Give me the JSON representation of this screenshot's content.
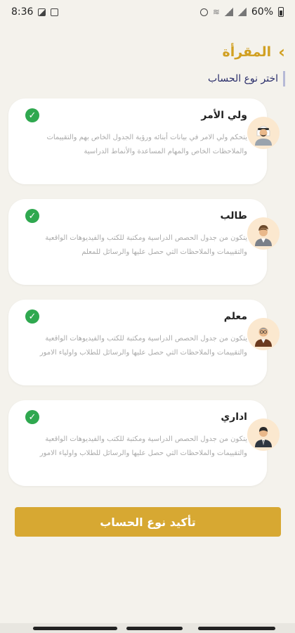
{
  "status_bar": {
    "time": "8:36",
    "battery": "60%"
  },
  "header": {
    "title": "المقرأة",
    "back_icon": "chevron-right-icon"
  },
  "subtitle": "اختر نوع الحساب",
  "cards": [
    {
      "title": "ولي الأمر",
      "desc": "يتحكم ولي الامر في بيانات أبنائه ورؤية الجدول الخاص بهم والتقييمات والملاحظات الخاص والمهام المساعدة والأنماط الدراسية",
      "checked": true
    },
    {
      "title": "طالب",
      "desc": "يتكون من جدول الحصص الدراسية ومكتبة للكتب والفيديوهات الواقعية والتقييمات والملاحظات التي حصل عليها والرسائل للمعلم",
      "checked": true
    },
    {
      "title": "معلم",
      "desc": "يتكون من جدول الحصص الدراسية ومكتبة للكتب والفيديوهات الواقعية والتقييمات والملاحظات التي حصل عليها والرسائل للطلاب واولياء الامور",
      "checked": true
    },
    {
      "title": "اداري",
      "desc": "يتكون من جدول الحصص الدراسية ومكتبة للكتب والفيديوهات الواقعية والتقييمات والملاحظات التي حصل عليها والرسائل للطلاب واولياء الامور",
      "checked": true
    }
  ],
  "confirm_button": "تأكيد نوع الحساب",
  "colors": {
    "accent": "#d7a832",
    "check": "#2fa84f",
    "subtitle": "#2b2f6b",
    "background": "#f4f2ec"
  }
}
